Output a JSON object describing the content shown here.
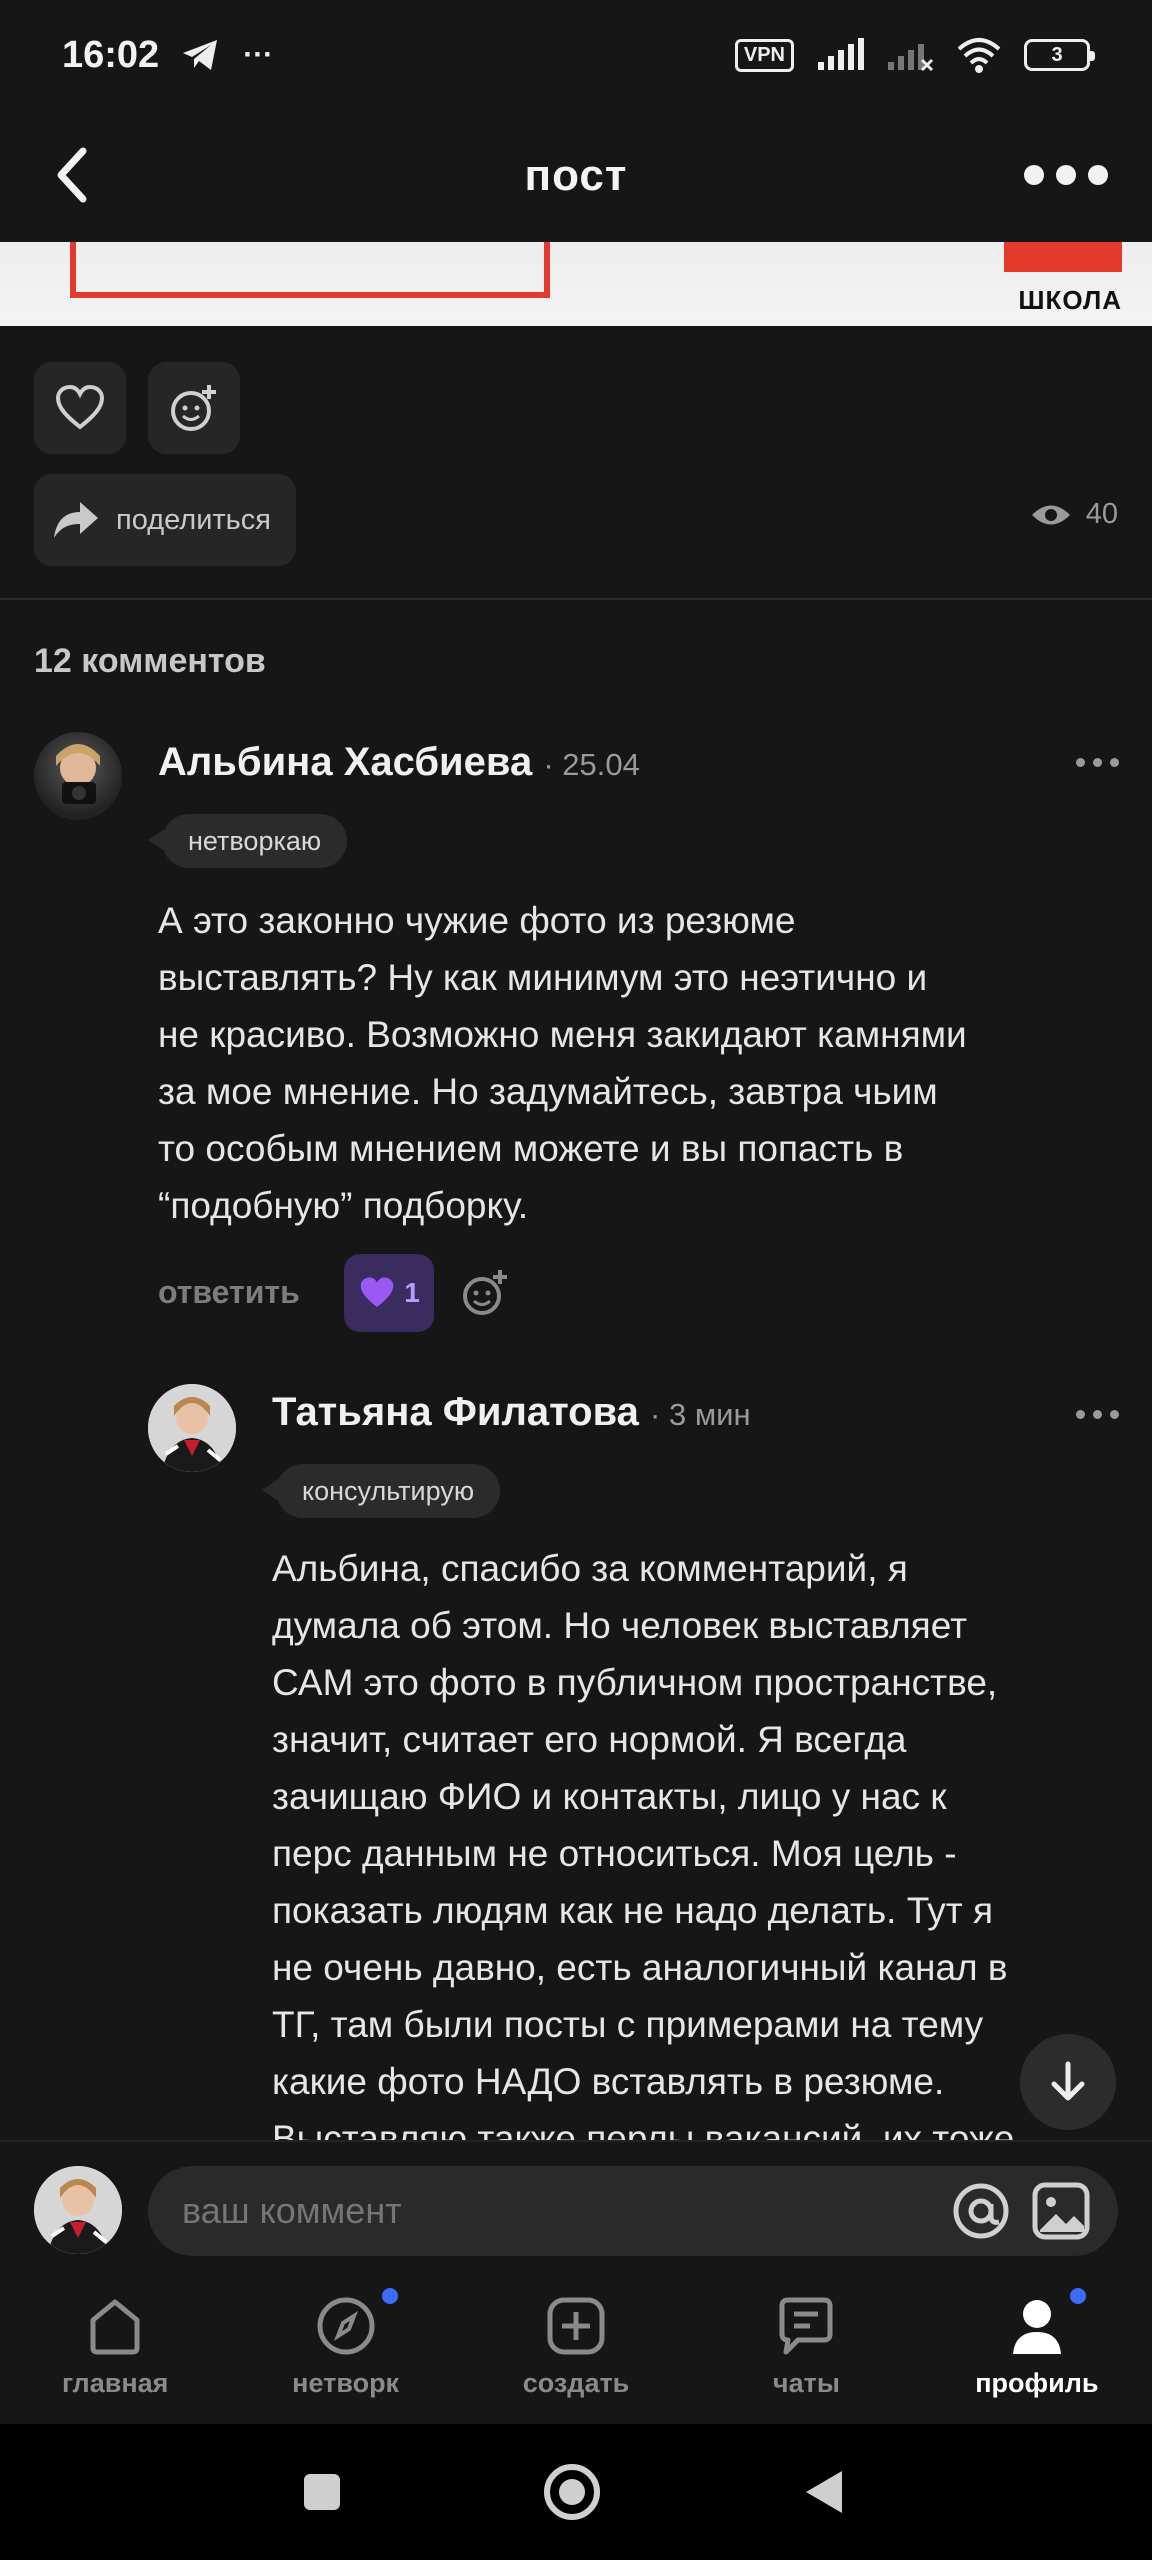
{
  "status_bar": {
    "time": "16:02",
    "vpn": "VPN",
    "battery": "3",
    "more": "···"
  },
  "header": {
    "title": "пост"
  },
  "post_image": {
    "logo_text": "ШКОЛА"
  },
  "actions": {
    "share_label": "поделиться",
    "views": "40"
  },
  "comments": {
    "count_label": "12 комментов",
    "items": [
      {
        "author": "Альбина Хасбиева",
        "date": "· 25.04",
        "tag": "нетворкаю",
        "text": "А это законно чужие фото из резюме\nвыставлять? Ну как минимум это неэтично и\nне красиво. Возможно меня закидают камнями\nза мое мнение. Но задумайтесь, завтра чьим\nто особым мнением можете и вы попасть в\n“подобную” подборку.",
        "reply_label": "ответить",
        "likes": "1"
      },
      {
        "author": "Татьяна Филатова",
        "date": "· 3 мин",
        "tag": "консультирую",
        "text": "Альбина, спасибо за комментарий, я\nдумала об этом. Но человек выставляет\nСАМ это фото в публичном пространстве,\nзначит, считает его нормой. Я всегда\nзачищаю ФИО и контакты, лицо у нас к\nперс данным не относиться. Моя цель -\nпоказать людям как не надо делать. Тут я\nне очень давно, есть аналогичный канал в\nТГ, там были посты с примерами на тему\nкакие фото НАДО вставлять в резюме.\nВыставляю также перлы вакансий, их тоже"
      }
    ]
  },
  "composer": {
    "placeholder": "ваш коммент"
  },
  "bottom_nav": {
    "items": [
      {
        "label": "главная",
        "icon": "home-icon"
      },
      {
        "label": "нетворк",
        "icon": "compass-icon"
      },
      {
        "label": "создать",
        "icon": "plus-square-icon"
      },
      {
        "label": "чаты",
        "icon": "chat-icon"
      },
      {
        "label": "профиль",
        "icon": "profile-icon"
      }
    ]
  },
  "colors": {
    "background": "#161616",
    "surface": "#262626",
    "like_accent": "#b79cff",
    "badge_blue": "#3b6cf6",
    "brand_red": "#e43a2e"
  }
}
